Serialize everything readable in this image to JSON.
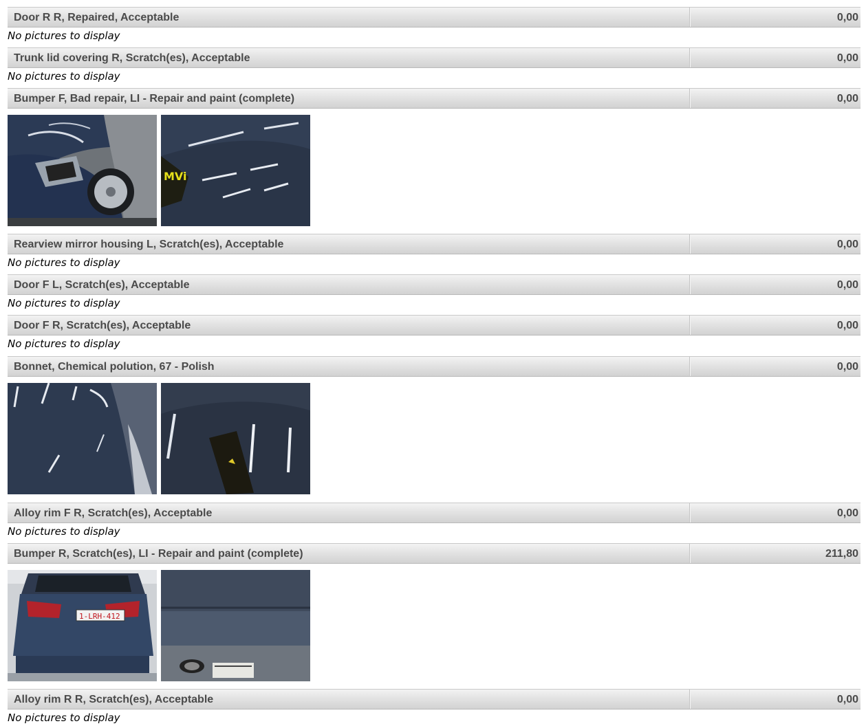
{
  "no_pictures_text": "No pictures to display",
  "damages": [
    {
      "description": "Door R R, Repaired, Acceptable",
      "amount": "0,00"
    },
    {
      "description": "Trunk lid covering R, Scratch(es), Acceptable",
      "amount": "0,00"
    },
    {
      "description": "Bumper F, Bad repair, LI - Repair and paint (complete)",
      "amount": "0,00",
      "photos": [
        "front-bumper-headlight-photo",
        "front-bumper-closeup-photo"
      ]
    },
    {
      "description": "Rearview mirror housing L, Scratch(es), Acceptable",
      "amount": "0,00"
    },
    {
      "description": "Door F L, Scratch(es), Acceptable",
      "amount": "0,00"
    },
    {
      "description": "Door F R, Scratch(es), Acceptable",
      "amount": "0,00"
    },
    {
      "description": "Bonnet, Chemical polution, 67 - Polish",
      "amount": "0,00",
      "photos": [
        "bonnet-photo",
        "bonnet-closeup-photo"
      ]
    },
    {
      "description": "Alloy rim F R, Scratch(es), Acceptable",
      "amount": "0,00"
    },
    {
      "description": "Bumper R, Scratch(es), LI - Repair and paint (complete)",
      "amount": "211,80",
      "photos": [
        "rear-view-photo",
        "rear-bumper-closeup-photo"
      ]
    },
    {
      "description": "Alloy rim R R, Scratch(es), Acceptable",
      "amount": "0,00"
    }
  ],
  "photo_text": {
    "mvi_tag": "MVi",
    "plate": "1-LRH-412"
  }
}
